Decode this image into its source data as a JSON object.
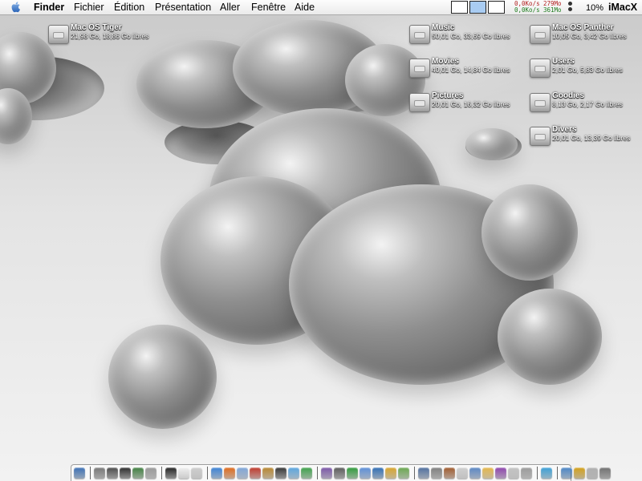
{
  "menubar": {
    "apple_icon": "apple-icon",
    "app_name": "Finder",
    "items": [
      "Fichier",
      "Édition",
      "Présentation",
      "Aller",
      "Fenêtre",
      "Aide"
    ],
    "network": {
      "line1_rate": "0,0Ko/s",
      "line1_size": "279Mo",
      "line2_rate": "0,0Ko/s",
      "line2_size": "361Mo"
    },
    "cpu_percent": "10%",
    "computer_name": "iMacX",
    "spaces": [
      "space-1",
      "space-2",
      "space-3"
    ],
    "active_space": 1
  },
  "drives": [
    {
      "name": "Mac OS Tiger",
      "info": "21,98 Go, 18,86 Go libres",
      "icon": "hard-drive-icon"
    },
    {
      "name": "Music",
      "info": "50,01 Go, 33,69 Go libres",
      "icon": "hard-drive-icon"
    },
    {
      "name": "Movies",
      "info": "40,01 Go, 14,84 Go libres",
      "icon": "hard-drive-icon"
    },
    {
      "name": "Pictures",
      "info": "20,01 Go, 16,32 Go libres",
      "icon": "hard-drive-icon"
    },
    {
      "name": "Mac OS Panther",
      "info": "10,05 Go, 3,42 Go libres",
      "icon": "hard-drive-icon"
    },
    {
      "name": "Users",
      "info": "2,01 Go, 5,83 Go libres",
      "icon": "hard-drive-icon"
    },
    {
      "name": "Goodies",
      "info": "8,13 Go, 2,17 Go libres",
      "icon": "hard-drive-icon"
    },
    {
      "name": "Divers",
      "info": "20,01 Go, 13,39 Go libres",
      "icon": "hard-drive-icon"
    }
  ],
  "colors": {
    "menubar_bg": "#f2f2f2",
    "active_space": "#a9ccf2",
    "net_rate": "#b22222",
    "net_size": "#1e7d1e",
    "drive_label": "#ffffff"
  },
  "dock": {
    "groups": [
      [
        "#3a6fb5"
      ],
      [
        "#777777",
        "#4a4a4a",
        "#2b2b2b",
        "#3f7f3f",
        "#999999"
      ],
      [
        "#222222",
        "#f0f0f0",
        "#cfcfcf"
      ],
      [
        "#3b82d6",
        "#e06a1a",
        "#7fa6d9",
        "#c0392b",
        "#b8862e",
        "#333333",
        "#5aa6e0",
        "#3da14a"
      ],
      [
        "#7a55a8",
        "#5a5a5a",
        "#2e9a3a",
        "#5b8fd9",
        "#2f6db5",
        "#d9a52b",
        "#6aa84f"
      ],
      [
        "#4f6f9f",
        "#7f7f7f",
        "#a05a2c",
        "#d0d0d0",
        "#5a87c5",
        "#e6b84a",
        "#8e44ad",
        "#c4c4c4",
        "#9b9b9b"
      ],
      [
        "#3aa0d8"
      ],
      [
        "#4a86c7",
        "#d4a017",
        "#b0b0b0",
        "#707070"
      ]
    ]
  }
}
